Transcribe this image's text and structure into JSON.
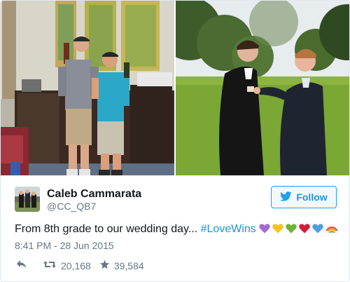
{
  "photos": {
    "left": {},
    "right": {}
  },
  "author": {
    "name": "Caleb Cammarata",
    "handle": "@CC_QB7"
  },
  "follow_button": {
    "label": "Follow",
    "icon": "twitter-bird-icon",
    "color": "#1da1f2"
  },
  "tweet": {
    "text": "From 8th grade to our wedding day... ",
    "hashtag": "#LoveWins",
    "emojis": [
      "purple-heart",
      "yellow-heart",
      "green-heart",
      "red-heart",
      "blue-heart",
      "rainbow"
    ],
    "timestamp": "8:41 PM - 28 Jun 2015"
  },
  "actions": {
    "reply_icon": "reply-icon",
    "retweets": "20,168",
    "likes": "39,584"
  }
}
